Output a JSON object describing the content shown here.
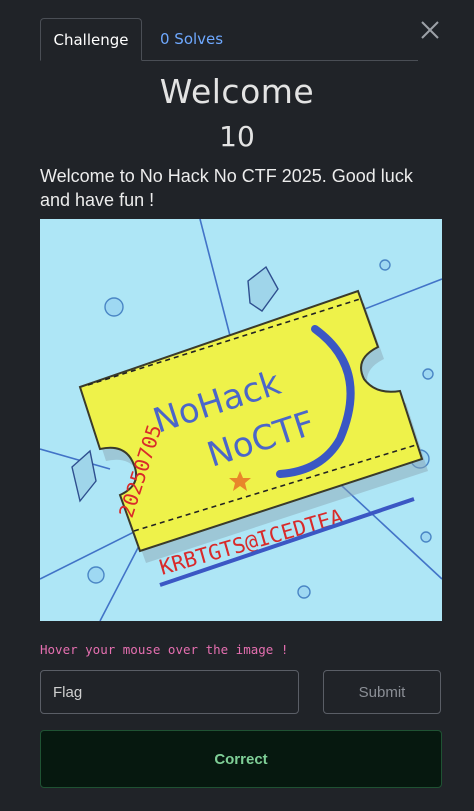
{
  "tabs": {
    "challenge": "Challenge",
    "solves": "0 Solves"
  },
  "challenge": {
    "title": "Welcome",
    "points": "10",
    "description": "Welcome to No Hack No CTF 2025. Good luck and have fun !"
  },
  "image": {
    "ticket_line1": "NoHack",
    "ticket_line2": "NoCTF",
    "ticket_date": "20250705",
    "ticket_signature": "KRBTGTS@ICEDTEA"
  },
  "hint": "Hover your mouse over the image !",
  "form": {
    "flag_placeholder": "Flag",
    "submit_label": "Submit"
  },
  "status": {
    "message": "Correct"
  },
  "colors": {
    "background": "#202328",
    "link": "#6ea8fe",
    "hint": "#e56fb0",
    "success_text": "#7fcf97",
    "success_bg": "#06180f",
    "image_bg": "#aee6f6",
    "ticket": "#eef24a"
  }
}
